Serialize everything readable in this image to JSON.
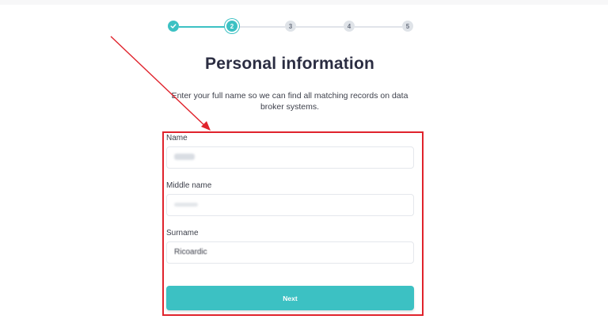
{
  "stepper": {
    "steps": [
      {
        "label": "",
        "state": "completed",
        "icon": "check-icon"
      },
      {
        "label": "2",
        "state": "active"
      },
      {
        "label": "3",
        "state": "pending"
      },
      {
        "label": "4",
        "state": "pending"
      },
      {
        "label": "5",
        "state": "pending"
      }
    ]
  },
  "header": {
    "title": "Personal information",
    "subtitle": "Enter your full name so we can find all matching records on data broker systems."
  },
  "form": {
    "name": {
      "label": "Name",
      "value": ""
    },
    "middle_name": {
      "label": "Middle name",
      "value": ""
    },
    "surname": {
      "label": "Surname",
      "value": "Ricoardic"
    },
    "next_label": "Next"
  },
  "colors": {
    "accent": "#3cc1c3",
    "annotation": "#e0232c",
    "step_pending": "#dfe3e8"
  }
}
